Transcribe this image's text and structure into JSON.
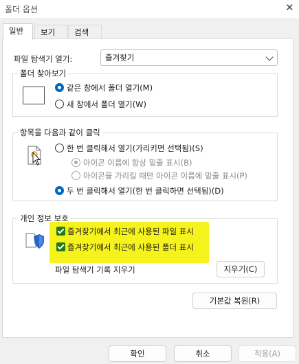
{
  "window": {
    "title": "폴더 옵션",
    "close_glyph": "✕"
  },
  "tabs": [
    {
      "label": "일반"
    },
    {
      "label": "보기"
    },
    {
      "label": "검색"
    }
  ],
  "explorer_open": {
    "label": "파일 탐색기 열기:",
    "value": "즐겨찾기"
  },
  "browse_folders": {
    "legend": "폴더 찾아보기",
    "options": [
      {
        "label": "같은 창에서 폴더 열기(M)",
        "selected": true
      },
      {
        "label": "새 창에서 폴더 열기(W)",
        "selected": false
      }
    ]
  },
  "click_items": {
    "legend": "항목을 다음과 같이 클릭",
    "single_click": "한 번 클릭해서 열기(가리키면 선택됨)(S)",
    "underline_always": "아이콘 이름에 항상 밑줄 표시(B)",
    "underline_hover": "아이콘을 가리킬 때만 아이콘 이름에 밑줄 표시(P)",
    "double_click": "두 번 클릭해서 열기(한 번 클릭하면 선택됨)(D)"
  },
  "privacy": {
    "legend": "개인 정보 보호",
    "show_recent_files": {
      "label": "즐겨찾기에서 최근에 사용된 파일 표시",
      "checked": true
    },
    "show_frequent_folders": {
      "label": "즐겨찾기에서 최근에 사용된 폴더 표시",
      "checked": true
    },
    "clear_history_label": "파일 탐색기 기록 지우기",
    "clear_button": "지우기(C)"
  },
  "restore_defaults_button": "기본값 복원(R)",
  "footer": {
    "ok": "확인",
    "cancel": "취소",
    "apply": "적용(A)"
  },
  "colors": {
    "accent": "#0067c0",
    "highlight": "#f5f21c",
    "check": "#217a13"
  }
}
